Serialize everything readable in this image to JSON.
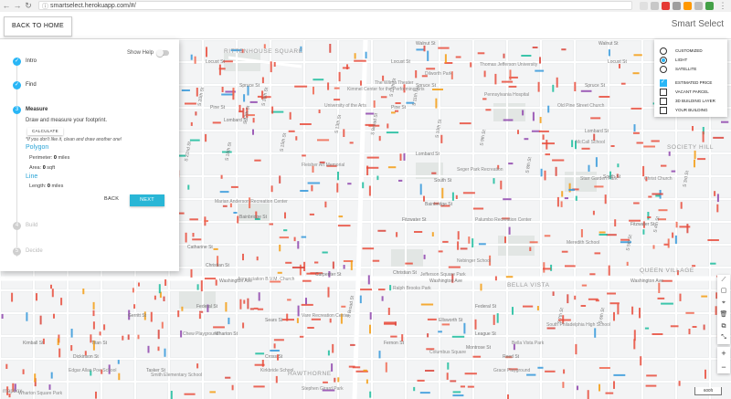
{
  "browser": {
    "url": "smartselect.herokuapp.com/#/"
  },
  "header": {
    "back_label": "BACK TO HOME",
    "title": "Smart Select"
  },
  "wizard": {
    "show_help_label": "Show Help",
    "steps": [
      {
        "num": "✓",
        "label": "Intro"
      },
      {
        "num": "✓",
        "label": "Find"
      },
      {
        "num": "3",
        "label": "Measure"
      },
      {
        "num": "4",
        "label": "Build"
      },
      {
        "num": "5",
        "label": "Decide"
      }
    ],
    "measure": {
      "description": "Draw and measure your footprint.",
      "calculate_label": "CALCULATE",
      "note": "*If you don't like it, clean and draw another one!",
      "polygon_title": "Polygon",
      "perimeter_label": "Perimeter:",
      "perimeter_value": "0",
      "perimeter_unit": "miles",
      "area_label": "Area:",
      "area_value": "0",
      "area_unit": "sqft",
      "line_title": "Line",
      "length_label": "Length:",
      "length_value": "0",
      "length_unit": "miles"
    },
    "back_label": "BACK",
    "next_label": "NEXT"
  },
  "layers": {
    "basemaps": [
      {
        "label": "CUSTOMIZED",
        "selected": false
      },
      {
        "label": "LIGHT",
        "selected": true
      },
      {
        "label": "SATELLITE",
        "selected": false
      }
    ],
    "overlays": [
      {
        "label": "ESTIMATED PRICE",
        "checked": true
      },
      {
        "label": "VACANT PARCEL",
        "checked": false
      },
      {
        "label": "3D BUILDING LAYER",
        "checked": false
      },
      {
        "label": "YOUR BUILDING",
        "checked": false
      }
    ]
  },
  "map": {
    "streets": [
      "Walnut St",
      "Walnut St",
      "Locust St",
      "Locust St",
      "Locust St",
      "Spruce St",
      "Spruce St",
      "Spruce St",
      "Pine St",
      "Pine St",
      "Lombard St",
      "Lombard St",
      "Lombard St",
      "South St",
      "South St",
      "Bainbridge St",
      "Bainbridge St",
      "Fitzwater St",
      "Fitzwater St",
      "Catharine St",
      "Christian St",
      "Christian St",
      "Carpenter St",
      "Washington Ave",
      "Washington Ave",
      "Washington Ave",
      "Federal St",
      "Federal St",
      "Ellsworth St",
      "Wharton St",
      "Reed St",
      "S Broad St",
      "S Broad St",
      "S 8th St",
      "S 9th St",
      "S 10th St",
      "S 11th St",
      "S 12th St",
      "S 13th St",
      "S 15th St",
      "S 16th St",
      "S 17th St",
      "S 18th St",
      "S 20th St",
      "S 22nd St",
      "S 3rd St",
      "S 4th St",
      "S 5th St",
      "S 6th St",
      "S 7th St",
      "Dickinson St",
      "Tasker St",
      "League St",
      "Montrose St",
      "Kimball St",
      "Titan St",
      "Fernon St",
      "Gerritt St",
      "Sears St",
      "Cross St"
    ],
    "places": [
      "The Wilma Theater",
      "Kimmel Center for the Performing Arts",
      "University of the Arts",
      "Thomas Jefferson University",
      "Pennsylvania Hospital",
      "Fleisher Art Memorial",
      "Marian Anderson Recreation Center",
      "Palumbo Recreation Center",
      "Seger Park Recreation",
      "Starr Garden Park",
      "McCall School",
      "Christ Church",
      "Old Pine Street Church",
      "Dilworth Park",
      "Meredith School",
      "Nebinger School",
      "Jefferson Square Park",
      "South Philadelphia High School",
      "Smith Elementary School",
      "Kirkbride School",
      "Vare Recreation Center",
      "Wharton Square Park",
      "Edgar Allan Poe School",
      "Chew Playground",
      "Ralph Brooks Park",
      "Bella Vista Park",
      "Columbus Square",
      "Grace Playground",
      "Stephen Girard Park",
      "Annunciation B.V.M. Church"
    ],
    "districts": [
      "RITTENHOUSE SQUARE",
      "SOCIETY HILL",
      "QUEEN VILLAGE",
      "BELLA VISTA",
      "HAWTHORNE"
    ],
    "scale_label": "600ft",
    "attribution": "mapbox"
  }
}
